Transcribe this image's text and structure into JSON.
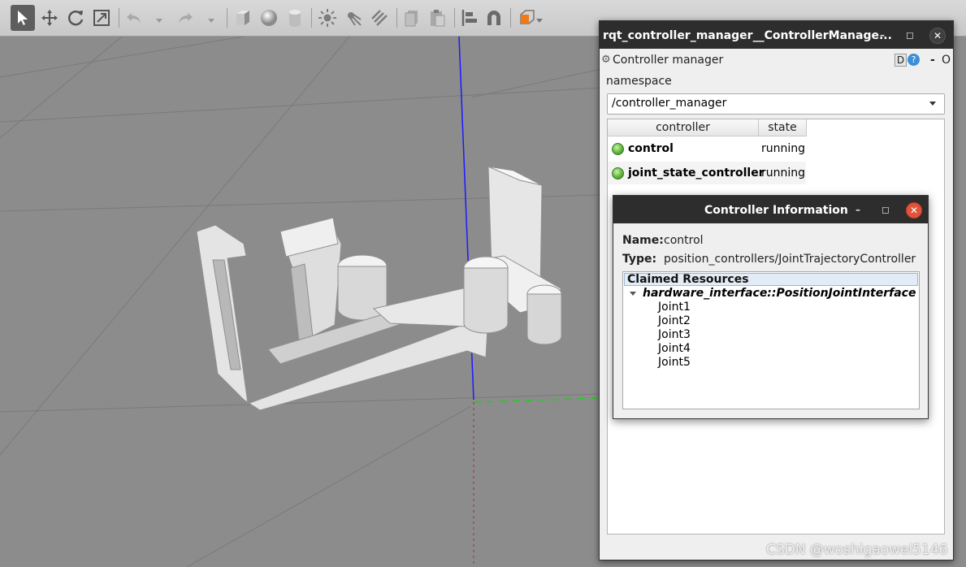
{
  "toolbar": {
    "tools": [
      {
        "icon": "select-arrow-icon",
        "active": true
      },
      {
        "icon": "translate-icon"
      },
      {
        "icon": "rotate-icon"
      },
      {
        "icon": "scale-icon"
      },
      {
        "icon": "undo-icon"
      },
      {
        "icon": "redo-icon"
      },
      {
        "icon": "box-shape-icon"
      },
      {
        "icon": "sphere-shape-icon"
      },
      {
        "icon": "cylinder-shape-icon"
      },
      {
        "icon": "point-light-icon"
      },
      {
        "icon": "spot-light-icon"
      },
      {
        "icon": "directional-light-icon"
      },
      {
        "icon": "copy-icon"
      },
      {
        "icon": "paste-icon"
      },
      {
        "icon": "align-icon"
      },
      {
        "icon": "snap-magnet-icon"
      },
      {
        "icon": "view-angle-cube-icon"
      }
    ]
  },
  "rqt_window": {
    "title": "rqt_controller_manager__ControllerManage...",
    "plugin_label": "Controller manager",
    "plugin_buttons": [
      "D",
      "?",
      "-",
      "O"
    ],
    "namespace_label": "namespace",
    "namespace_value": "/controller_manager",
    "table": {
      "columns": [
        "controller",
        "state"
      ],
      "rows": [
        {
          "name": "control",
          "state": "running"
        },
        {
          "name": "joint_state_controller",
          "state": "running"
        }
      ]
    }
  },
  "info_dialog": {
    "title": "Controller Information",
    "name_label": "Name:",
    "name_value": "control",
    "type_label": "Type:",
    "type_value": "position_controllers/JointTrajectoryController",
    "resources_header": "Claimed Resources",
    "interface": "hardware_interface::PositionJointInterface",
    "joints": [
      "Joint1",
      "Joint2",
      "Joint3",
      "Joint4",
      "Joint5"
    ]
  },
  "watermark": "CSDN @woshigaowei5146",
  "colors": {
    "titlebar": "#2d2d2d",
    "close_red": "#e2543a",
    "running_led": "#5fb53a",
    "z_axis": "#1a1aff",
    "y_axis": "#22cc22"
  }
}
